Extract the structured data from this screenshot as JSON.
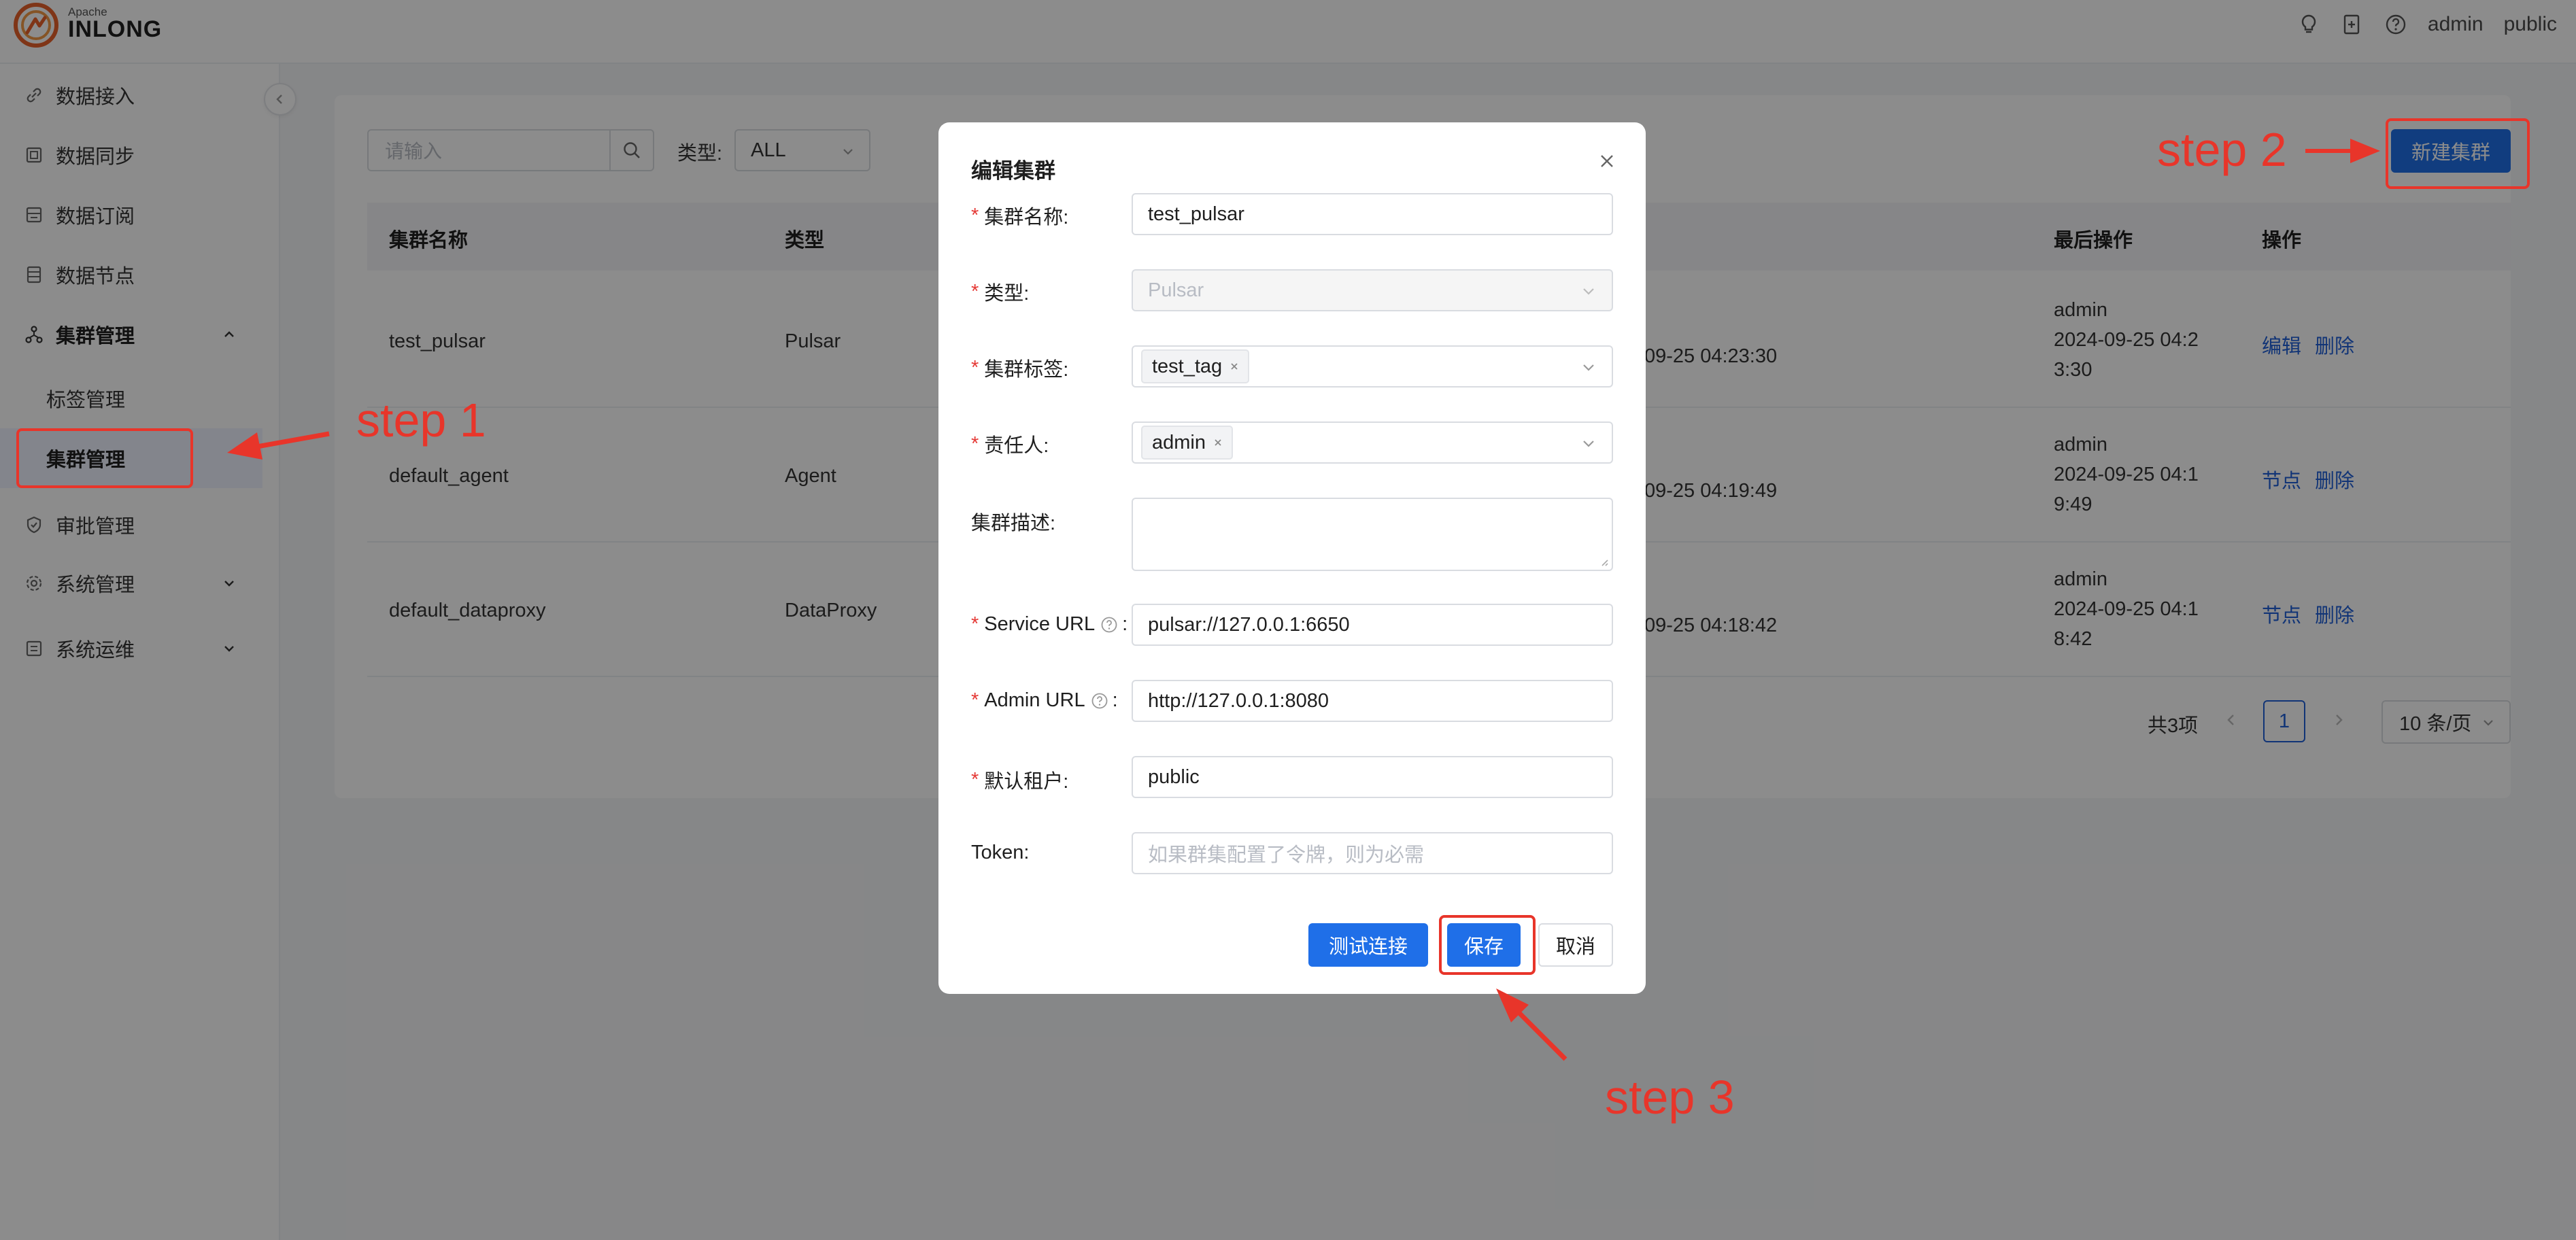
{
  "brand": {
    "small": "Apache",
    "name": "INLONG"
  },
  "topbar": {
    "user": "admin",
    "tenant": "public",
    "icons": [
      "bulb-icon",
      "add-document-icon",
      "help-circle-icon"
    ]
  },
  "sidebar": {
    "items": [
      {
        "label": "数据接入",
        "icon": "link-icon"
      },
      {
        "label": "数据同步",
        "icon": "sync-icon"
      },
      {
        "label": "数据订阅",
        "icon": "subscribe-icon"
      },
      {
        "label": "数据节点",
        "icon": "node-icon"
      },
      {
        "label": "集群管理",
        "icon": "cluster-icon",
        "expanded": true
      },
      {
        "label": "审批管理",
        "icon": "shield-check-icon"
      },
      {
        "label": "系统管理",
        "icon": "gear-icon"
      },
      {
        "label": "系统运维",
        "icon": "ops-icon"
      }
    ],
    "subitems": [
      {
        "label": "标签管理"
      },
      {
        "label": "集群管理",
        "active": true
      }
    ]
  },
  "toolbar": {
    "search_placeholder": "请输入",
    "type_label": "类型:",
    "type_value": "ALL",
    "new_button": "新建集群"
  },
  "table": {
    "headers": {
      "name": "集群名称",
      "type": "类型",
      "last_op": "最后操作",
      "actions": "操作"
    },
    "rows": [
      {
        "name": "test_pulsar",
        "type": "Pulsar",
        "modified_fragment": "09-25 04:23:30",
        "last_user": "admin",
        "last_time_line1": "2024-09-25 04:2",
        "last_time_line2": "3:30",
        "action1": "编辑",
        "action2": "删除"
      },
      {
        "name": "default_agent",
        "type": "Agent",
        "modified_fragment": "09-25 04:19:49",
        "last_user": "admin",
        "last_time_line1": "2024-09-25 04:1",
        "last_time_line2": "9:49",
        "action1": "节点",
        "action2": "删除"
      },
      {
        "name": "default_dataproxy",
        "type": "DataProxy",
        "modified_fragment": "09-25 04:18:42",
        "last_user": "admin",
        "last_time_line1": "2024-09-25 04:1",
        "last_time_line2": "8:42",
        "action1": "节点",
        "action2": "删除"
      }
    ]
  },
  "pagination": {
    "total": "共3项",
    "page": "1",
    "page_size": "10 条/页"
  },
  "modal": {
    "title": "编辑集群",
    "fields": {
      "name": {
        "label": "集群名称:",
        "value": "test_pulsar"
      },
      "type": {
        "label": "类型:",
        "value": "Pulsar"
      },
      "tags": {
        "label": "集群标签:",
        "value": "test_tag"
      },
      "owner": {
        "label": "责任人:",
        "value": "admin"
      },
      "desc": {
        "label": "集群描述:"
      },
      "service_url": {
        "label": "Service URL",
        "value": "pulsar://127.0.0.1:6650"
      },
      "admin_url": {
        "label": "Admin URL",
        "value": "http://127.0.0.1:8080"
      },
      "tenant": {
        "label": "默认租户:",
        "value": "public"
      },
      "token": {
        "label": "Token:",
        "placeholder": "如果群集配置了令牌，则为必需"
      }
    },
    "buttons": {
      "test": "测试连接",
      "save": "保存",
      "cancel": "取消"
    }
  },
  "annotations": {
    "step1": "step 1",
    "step2": "step 2",
    "step3": "step 3",
    "color": "#e8352a"
  },
  "colors": {
    "primary": "#1f6fe8",
    "link": "#1f5fd8",
    "required": "#e53935",
    "brand_orange": "#e8622a"
  }
}
